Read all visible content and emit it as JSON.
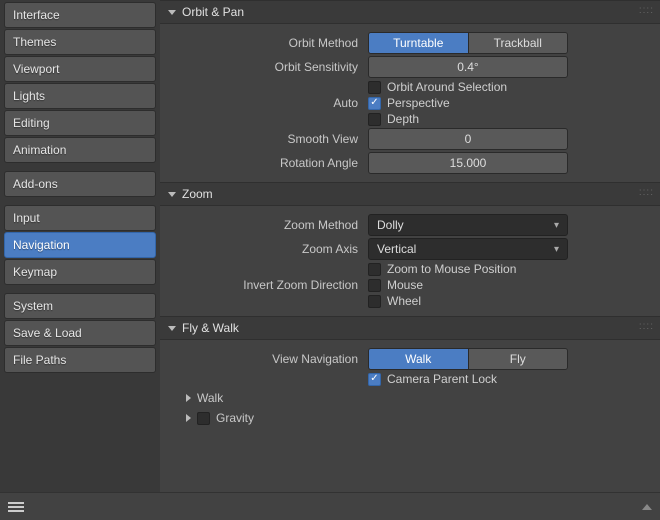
{
  "sidebar": {
    "groups": [
      [
        "Interface",
        "Themes",
        "Viewport",
        "Lights",
        "Editing",
        "Animation"
      ],
      [
        "Add-ons"
      ],
      [
        "Input",
        "Navigation",
        "Keymap"
      ],
      [
        "System",
        "Save & Load",
        "File Paths"
      ]
    ],
    "selected": "Navigation"
  },
  "panels": {
    "orbit": {
      "title": "Orbit & Pan",
      "orbit_method": {
        "label": "Orbit Method",
        "options": [
          "Turntable",
          "Trackball"
        ],
        "active": 0
      },
      "orbit_sensitivity": {
        "label": "Orbit Sensitivity",
        "value": "0.4°"
      },
      "orbit_around_selection": {
        "label": "Orbit Around Selection",
        "checked": false
      },
      "auto": {
        "label": "Auto",
        "perspective": {
          "label": "Perspective",
          "checked": true
        },
        "depth": {
          "label": "Depth",
          "checked": false
        }
      },
      "smooth_view": {
        "label": "Smooth View",
        "value": "0"
      },
      "rotation_angle": {
        "label": "Rotation Angle",
        "value": "15.000"
      }
    },
    "zoom": {
      "title": "Zoom",
      "zoom_method": {
        "label": "Zoom Method",
        "value": "Dolly"
      },
      "zoom_axis": {
        "label": "Zoom Axis",
        "value": "Vertical"
      },
      "zoom_to_mouse": {
        "label": "Zoom to Mouse Position",
        "checked": false
      },
      "invert": {
        "label": "Invert Zoom Direction",
        "mouse": {
          "label": "Mouse",
          "checked": false
        },
        "wheel": {
          "label": "Wheel",
          "checked": false
        }
      }
    },
    "fly": {
      "title": "Fly & Walk",
      "view_nav": {
        "label": "View Navigation",
        "options": [
          "Walk",
          "Fly"
        ],
        "active": 0
      },
      "camera_parent_lock": {
        "label": "Camera Parent Lock",
        "checked": true
      },
      "walk_sub": "Walk",
      "gravity_sub": {
        "label": "Gravity",
        "checked": false
      }
    }
  }
}
